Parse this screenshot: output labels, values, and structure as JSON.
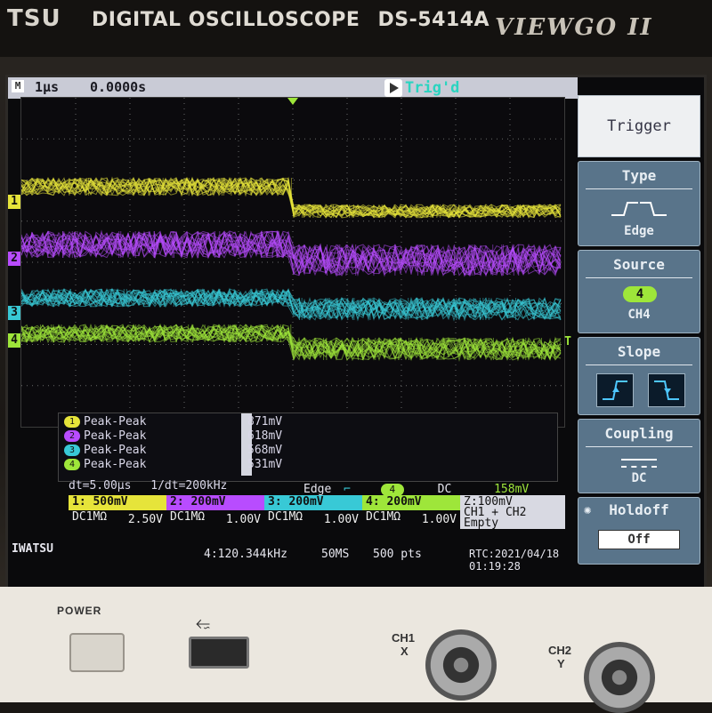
{
  "brand": {
    "logo": "TSU",
    "title": "DIGITAL OSCILLOSCOPE",
    "model": "DS-5414A",
    "series": "VIEWGO II"
  },
  "status": {
    "timebase": "1μs",
    "position": "0.0000s",
    "trigger_state": "Trig'd"
  },
  "channel_colors": {
    "ch1": "#e6e43a",
    "ch2": "#b84cff",
    "ch3": "#38c9d6",
    "ch4": "#9ee63a"
  },
  "measurements": [
    {
      "ch": "1",
      "label": "Peak-Peak",
      "value": "871mV"
    },
    {
      "ch": "2",
      "label": "Peak-Peak",
      "value": "618mV"
    },
    {
      "ch": "3",
      "label": "Peak-Peak",
      "value": "568mV"
    },
    {
      "ch": "4",
      "label": "Peak-Peak",
      "value": "531mV"
    }
  ],
  "cursor": {
    "dt": "dt=5.00μs",
    "inv_dt": "1/dt=200kHz"
  },
  "channels": [
    {
      "label": "1: 500mV",
      "coupling": "DC1MΩ",
      "offset": "2.50V"
    },
    {
      "label": "2: 200mV",
      "coupling": "DC1MΩ",
      "offset": "1.00V"
    },
    {
      "label": "3: 200mV",
      "coupling": "DC1MΩ",
      "offset": "1.00V"
    },
    {
      "label": "4: 200mV",
      "coupling": "DC1MΩ",
      "offset": "1.00V"
    }
  ],
  "trigger_info": {
    "mode": "Edge",
    "source": "4",
    "coupling": "DC",
    "level": "158mV"
  },
  "footer": {
    "brand": "IWATSU",
    "freq": "4:120.344kHz",
    "rate": "50MS",
    "points": "500 pts",
    "rtc": "RTC:2021/04/18 01:19:28",
    "zoom_scale": "Z:100mV",
    "zoom_src": "CH1 + CH2",
    "status": "Empty"
  },
  "menu": {
    "title": "Trigger",
    "type_label": "Type",
    "type_value": "Edge",
    "source_label": "Source",
    "source_value": "4",
    "source_ch": "CH4",
    "slope_label": "Slope",
    "coupling_label": "Coupling",
    "coupling_value": "DC",
    "holdoff_label": "Holdoff",
    "holdoff_value": "Off"
  },
  "panel": {
    "power_label": "POWER",
    "ch1_label": "CH1",
    "ch1_sub": "X",
    "ch2_label": "CH2",
    "ch2_sub": "Y"
  }
}
